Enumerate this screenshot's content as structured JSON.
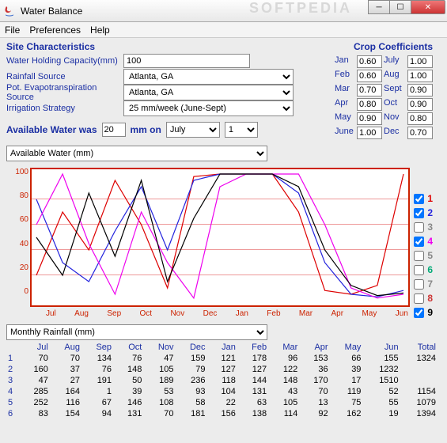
{
  "window": {
    "title": "Water Balance",
    "watermark": "SOFTPEDIA"
  },
  "menu": [
    "File",
    "Preferences",
    "Help"
  ],
  "headings": {
    "site": "Site Characteristics",
    "cropcoef": "Crop Coefficients"
  },
  "form": {
    "whc_label": "Water Holding Capacity(mm)",
    "whc_value": "100",
    "rain_label": "Rainfall Source",
    "rain_value": "Atlanta, GA",
    "pet_label": "Pot. Evapotranspiration Source",
    "pet_value": "Atlanta, GA",
    "irr_label": "Irrigation Strategy",
    "irr_value": "25 mm/week (June-Sept)"
  },
  "avail": {
    "label": "Available Water was",
    "value": "20",
    "unit": "mm  on",
    "month": "July",
    "day": "1"
  },
  "coef": {
    "months_left": [
      "Jan",
      "Feb",
      "Mar",
      "Apr",
      "May",
      "June"
    ],
    "values_left": [
      "0.60",
      "0.60",
      "0.70",
      "0.80",
      "0.90",
      "1.00"
    ],
    "months_right": [
      "July",
      "Aug",
      "Sept",
      "Oct",
      "Nov",
      "Dec"
    ],
    "values_right": [
      "1.00",
      "1.00",
      "0.90",
      "0.90",
      "0.80",
      "0.70"
    ]
  },
  "plot_selector": "Available Water (mm)",
  "table_selector": "Monthly Rainfall (mm)",
  "series": [
    {
      "n": "1",
      "checked": true,
      "color": "#d00"
    },
    {
      "n": "2",
      "checked": true,
      "color": "#22d"
    },
    {
      "n": "3",
      "checked": false,
      "color": "#888"
    },
    {
      "n": "4",
      "checked": true,
      "color": "#e0e"
    },
    {
      "n": "5",
      "checked": false,
      "color": "#888"
    },
    {
      "n": "6",
      "checked": false,
      "color": "#0a7"
    },
    {
      "n": "7",
      "checked": false,
      "color": "#888"
    },
    {
      "n": "8",
      "checked": false,
      "color": "#c33"
    },
    {
      "n": "9",
      "checked": true,
      "color": "#000"
    }
  ],
  "chart_data": {
    "type": "line",
    "ylim": [
      0,
      100
    ],
    "yticks": [
      0,
      20,
      40,
      60,
      80,
      100
    ],
    "x_months": [
      "Jul",
      "Aug",
      "Sep",
      "Oct",
      "Nov",
      "Dec",
      "Jan",
      "Feb",
      "Mar",
      "Apr",
      "May",
      "Jun"
    ],
    "series": [
      {
        "name": "1",
        "color": "#d00",
        "values": [
          20,
          70,
          40,
          95,
          60,
          10,
          98,
          100,
          100,
          100,
          70,
          8,
          5,
          12,
          100
        ]
      },
      {
        "name": "2",
        "color": "#22d",
        "values": [
          80,
          30,
          15,
          55,
          90,
          40,
          95,
          100,
          100,
          100,
          85,
          30,
          5,
          3,
          8
        ]
      },
      {
        "name": "4",
        "color": "#e0e",
        "values": [
          60,
          100,
          45,
          5,
          70,
          30,
          2,
          90,
          100,
          100,
          100,
          60,
          10,
          2,
          5
        ]
      },
      {
        "name": "9",
        "color": "#000",
        "values": [
          50,
          20,
          85,
          35,
          95,
          15,
          65,
          100,
          100,
          100,
          90,
          40,
          12,
          4,
          6
        ]
      }
    ]
  },
  "rain_table": {
    "headers": [
      "",
      "Jul",
      "Aug",
      "Sep",
      "Oct",
      "Nov",
      "Dec",
      "Jan",
      "Feb",
      "Mar",
      "Apr",
      "May",
      "Jun",
      "Total"
    ],
    "rows": [
      [
        "1",
        70,
        70,
        134,
        76,
        47,
        159,
        121,
        178,
        96,
        153,
        66,
        155,
        1324
      ],
      [
        "2",
        160,
        37,
        76,
        148,
        105,
        79,
        127,
        127,
        122,
        36,
        39,
        1232
      ],
      [
        "3",
        47,
        27,
        191,
        50,
        189,
        236,
        118,
        144,
        148,
        170,
        17,
        1510
      ],
      [
        "4",
        285,
        164,
        1,
        39,
        53,
        93,
        104,
        131,
        43,
        70,
        119,
        52,
        1154
      ],
      [
        "5",
        252,
        116,
        67,
        146,
        108,
        58,
        22,
        63,
        105,
        13,
        75,
        55,
        1079
      ],
      [
        "6",
        83,
        154,
        94,
        131,
        70,
        181,
        156,
        138,
        114,
        92,
        162,
        19,
        1394
      ]
    ]
  }
}
